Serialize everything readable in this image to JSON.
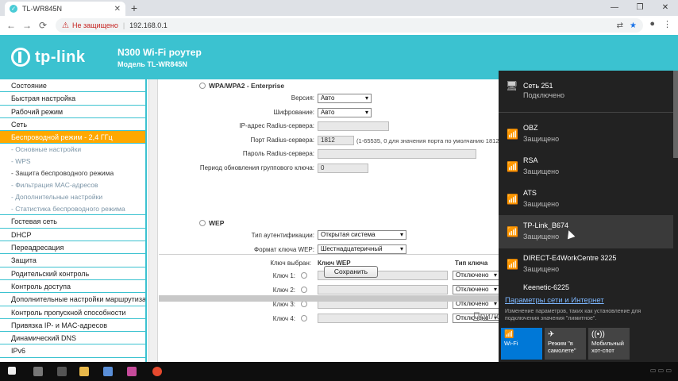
{
  "browser": {
    "tab_title": "TL-WR845N",
    "tab_close": "✕",
    "new_tab": "+",
    "win_min": "—",
    "win_max": "❐",
    "win_close": "✕",
    "nav_back": "←",
    "nav_forward": "→",
    "nav_reload": "⟳",
    "security_icon": "⚠",
    "security_text": "Не защищено",
    "url": "192.168.0.1"
  },
  "router": {
    "logo": "tp-link",
    "title": "N300 Wi-Fi роутер",
    "model": "Модель TL-WR845N"
  },
  "sidebar": {
    "items": [
      {
        "label": "Состояние"
      },
      {
        "label": "Быстрая настройка"
      },
      {
        "label": "Рабочий режим"
      },
      {
        "label": "Сеть"
      },
      {
        "label": "Беспроводной режим - 2,4 ГГц"
      }
    ],
    "subitems": [
      {
        "label": "- Основные настройки"
      },
      {
        "label": "- WPS"
      },
      {
        "label": "- Защита беспроводного режима"
      },
      {
        "label": "- Фильтрация MAC-адресов"
      },
      {
        "label": "- Дополнительные настройки"
      },
      {
        "label": "- Статистика беспроводного режима"
      }
    ],
    "items2": [
      {
        "label": "Гостевая сеть"
      },
      {
        "label": "DHCP"
      },
      {
        "label": "Переадресация"
      },
      {
        "label": "Защита"
      },
      {
        "label": "Родительский контроль"
      },
      {
        "label": "Контроль доступа"
      },
      {
        "label": "Дополнительные настройки маршрутизации"
      },
      {
        "label": "Контроль пропускной способности"
      },
      {
        "label": "Привязка IP- и MAC-адресов"
      },
      {
        "label": "Динамический DNS"
      },
      {
        "label": "IPv6"
      }
    ]
  },
  "enterprise": {
    "title": "WPA/WPA2 - Enterprise",
    "version_label": "Версия:",
    "version_value": "Авто",
    "encryption_label": "Шифрование:",
    "encryption_value": "Авто",
    "radius_ip_label": "IP-адрес Radius-сервера:",
    "radius_ip_value": "",
    "radius_port_label": "Порт Radius-сервера:",
    "radius_port_value": "1812",
    "radius_port_hint": "(1-65535, 0 для значения порта по умолчанию 1812)",
    "radius_pass_label": "Пароль Radius-сервера:",
    "radius_pass_value": "",
    "group_key_label": "Период обновления группового ключа:",
    "group_key_value": "0"
  },
  "wep": {
    "title": "WEP",
    "auth_label": "Тип аутентификации:",
    "auth_value": "Открытая система",
    "format_label": "Формат ключа WEP:",
    "format_value": "Шестнадцатеричный",
    "key_selected_label": "Ключ выбран:",
    "key_wep_header": "Ключ WEP",
    "key_type_header": "Тип ключа",
    "keys": [
      {
        "label": "Ключ 1:",
        "value": "",
        "type": "Отключено"
      },
      {
        "label": "Ключ 2:",
        "value": "",
        "type": "Отключено"
      },
      {
        "label": "Ключ 3:",
        "value": "",
        "type": "Отключено"
      },
      {
        "label": "Ключ 4:",
        "value": "",
        "type": "Отключено"
      }
    ]
  },
  "save_button": "Сохранить",
  "app_link_partial": "Прило",
  "wifi": {
    "connected": {
      "name": "Сеть 251",
      "status": "Подключено"
    },
    "networks": [
      {
        "name": "OBZ",
        "status": "Защищено"
      },
      {
        "name": "RSA",
        "status": "Защищено"
      },
      {
        "name": "ATS",
        "status": "Защищено"
      },
      {
        "name": "TP-Link_B674",
        "status": "Защищено"
      },
      {
        "name": "DIRECT-E4WorkCentre 3225",
        "status": "Защищено"
      },
      {
        "name": "Keenetic-6225",
        "status": ""
      }
    ],
    "settings_link": "Параметры сети и Интернет",
    "settings_desc": "Изменение параметров, таких как установление для подключения значения \"лимитное\".",
    "tiles": [
      {
        "label": "Wi-Fi",
        "active": true
      },
      {
        "label": "Режим \"в самолете\"",
        "active": false
      },
      {
        "label": "Мобильный хот-спот",
        "active": false
      }
    ]
  },
  "colors": {
    "brand": "#3bc2d0",
    "active_menu": "#ffa800",
    "flyout_bg": "#222222",
    "tile_active": "#0078d7"
  }
}
